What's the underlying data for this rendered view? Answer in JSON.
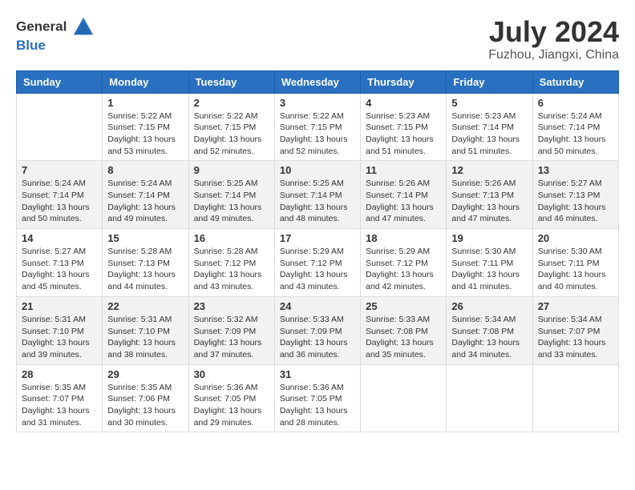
{
  "header": {
    "logo_general": "General",
    "logo_blue": "Blue",
    "month_year": "July 2024",
    "location": "Fuzhou, Jiangxi, China"
  },
  "weekdays": [
    "Sunday",
    "Monday",
    "Tuesday",
    "Wednesday",
    "Thursday",
    "Friday",
    "Saturday"
  ],
  "weeks": [
    [
      {
        "day": "",
        "sunrise": "",
        "sunset": "",
        "daylight": ""
      },
      {
        "day": "1",
        "sunrise": "Sunrise: 5:22 AM",
        "sunset": "Sunset: 7:15 PM",
        "daylight": "Daylight: 13 hours and 53 minutes."
      },
      {
        "day": "2",
        "sunrise": "Sunrise: 5:22 AM",
        "sunset": "Sunset: 7:15 PM",
        "daylight": "Daylight: 13 hours and 52 minutes."
      },
      {
        "day": "3",
        "sunrise": "Sunrise: 5:22 AM",
        "sunset": "Sunset: 7:15 PM",
        "daylight": "Daylight: 13 hours and 52 minutes."
      },
      {
        "day": "4",
        "sunrise": "Sunrise: 5:23 AM",
        "sunset": "Sunset: 7:15 PM",
        "daylight": "Daylight: 13 hours and 51 minutes."
      },
      {
        "day": "5",
        "sunrise": "Sunrise: 5:23 AM",
        "sunset": "Sunset: 7:14 PM",
        "daylight": "Daylight: 13 hours and 51 minutes."
      },
      {
        "day": "6",
        "sunrise": "Sunrise: 5:24 AM",
        "sunset": "Sunset: 7:14 PM",
        "daylight": "Daylight: 13 hours and 50 minutes."
      }
    ],
    [
      {
        "day": "7",
        "sunrise": "Sunrise: 5:24 AM",
        "sunset": "Sunset: 7:14 PM",
        "daylight": "Daylight: 13 hours and 50 minutes."
      },
      {
        "day": "8",
        "sunrise": "Sunrise: 5:24 AM",
        "sunset": "Sunset: 7:14 PM",
        "daylight": "Daylight: 13 hours and 49 minutes."
      },
      {
        "day": "9",
        "sunrise": "Sunrise: 5:25 AM",
        "sunset": "Sunset: 7:14 PM",
        "daylight": "Daylight: 13 hours and 49 minutes."
      },
      {
        "day": "10",
        "sunrise": "Sunrise: 5:25 AM",
        "sunset": "Sunset: 7:14 PM",
        "daylight": "Daylight: 13 hours and 48 minutes."
      },
      {
        "day": "11",
        "sunrise": "Sunrise: 5:26 AM",
        "sunset": "Sunset: 7:14 PM",
        "daylight": "Daylight: 13 hours and 47 minutes."
      },
      {
        "day": "12",
        "sunrise": "Sunrise: 5:26 AM",
        "sunset": "Sunset: 7:13 PM",
        "daylight": "Daylight: 13 hours and 47 minutes."
      },
      {
        "day": "13",
        "sunrise": "Sunrise: 5:27 AM",
        "sunset": "Sunset: 7:13 PM",
        "daylight": "Daylight: 13 hours and 46 minutes."
      }
    ],
    [
      {
        "day": "14",
        "sunrise": "Sunrise: 5:27 AM",
        "sunset": "Sunset: 7:13 PM",
        "daylight": "Daylight: 13 hours and 45 minutes."
      },
      {
        "day": "15",
        "sunrise": "Sunrise: 5:28 AM",
        "sunset": "Sunset: 7:13 PM",
        "daylight": "Daylight: 13 hours and 44 minutes."
      },
      {
        "day": "16",
        "sunrise": "Sunrise: 5:28 AM",
        "sunset": "Sunset: 7:12 PM",
        "daylight": "Daylight: 13 hours and 43 minutes."
      },
      {
        "day": "17",
        "sunrise": "Sunrise: 5:29 AM",
        "sunset": "Sunset: 7:12 PM",
        "daylight": "Daylight: 13 hours and 43 minutes."
      },
      {
        "day": "18",
        "sunrise": "Sunrise: 5:29 AM",
        "sunset": "Sunset: 7:12 PM",
        "daylight": "Daylight: 13 hours and 42 minutes."
      },
      {
        "day": "19",
        "sunrise": "Sunrise: 5:30 AM",
        "sunset": "Sunset: 7:11 PM",
        "daylight": "Daylight: 13 hours and 41 minutes."
      },
      {
        "day": "20",
        "sunrise": "Sunrise: 5:30 AM",
        "sunset": "Sunset: 7:11 PM",
        "daylight": "Daylight: 13 hours and 40 minutes."
      }
    ],
    [
      {
        "day": "21",
        "sunrise": "Sunrise: 5:31 AM",
        "sunset": "Sunset: 7:10 PM",
        "daylight": "Daylight: 13 hours and 39 minutes."
      },
      {
        "day": "22",
        "sunrise": "Sunrise: 5:31 AM",
        "sunset": "Sunset: 7:10 PM",
        "daylight": "Daylight: 13 hours and 38 minutes."
      },
      {
        "day": "23",
        "sunrise": "Sunrise: 5:32 AM",
        "sunset": "Sunset: 7:09 PM",
        "daylight": "Daylight: 13 hours and 37 minutes."
      },
      {
        "day": "24",
        "sunrise": "Sunrise: 5:33 AM",
        "sunset": "Sunset: 7:09 PM",
        "daylight": "Daylight: 13 hours and 36 minutes."
      },
      {
        "day": "25",
        "sunrise": "Sunrise: 5:33 AM",
        "sunset": "Sunset: 7:08 PM",
        "daylight": "Daylight: 13 hours and 35 minutes."
      },
      {
        "day": "26",
        "sunrise": "Sunrise: 5:34 AM",
        "sunset": "Sunset: 7:08 PM",
        "daylight": "Daylight: 13 hours and 34 minutes."
      },
      {
        "day": "27",
        "sunrise": "Sunrise: 5:34 AM",
        "sunset": "Sunset: 7:07 PM",
        "daylight": "Daylight: 13 hours and 33 minutes."
      }
    ],
    [
      {
        "day": "28",
        "sunrise": "Sunrise: 5:35 AM",
        "sunset": "Sunset: 7:07 PM",
        "daylight": "Daylight: 13 hours and 31 minutes."
      },
      {
        "day": "29",
        "sunrise": "Sunrise: 5:35 AM",
        "sunset": "Sunset: 7:06 PM",
        "daylight": "Daylight: 13 hours and 30 minutes."
      },
      {
        "day": "30",
        "sunrise": "Sunrise: 5:36 AM",
        "sunset": "Sunset: 7:05 PM",
        "daylight": "Daylight: 13 hours and 29 minutes."
      },
      {
        "day": "31",
        "sunrise": "Sunrise: 5:36 AM",
        "sunset": "Sunset: 7:05 PM",
        "daylight": "Daylight: 13 hours and 28 minutes."
      },
      {
        "day": "",
        "sunrise": "",
        "sunset": "",
        "daylight": ""
      },
      {
        "day": "",
        "sunrise": "",
        "sunset": "",
        "daylight": ""
      },
      {
        "day": "",
        "sunrise": "",
        "sunset": "",
        "daylight": ""
      }
    ]
  ]
}
